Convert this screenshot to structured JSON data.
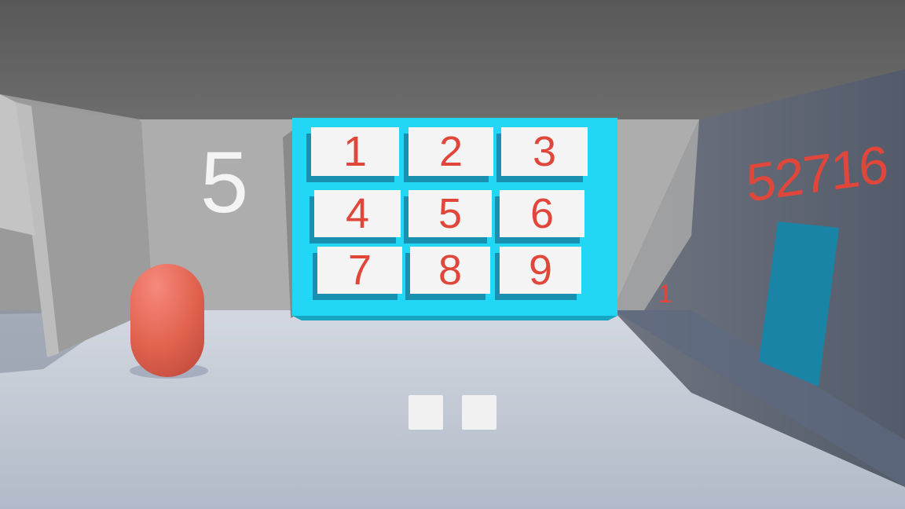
{
  "scene": {
    "colors": {
      "ceiling": "#5f5f5f",
      "back_wall": "#adadad",
      "floor": "#c2c9d6",
      "keypad_frame": "#22d6f5",
      "key_face": "#f4f4f4",
      "key_text": "#e0473a",
      "door": "#1a84a6",
      "capsule": "#e86a5c"
    },
    "wall_digit": "5",
    "keypad": {
      "keys": [
        "1",
        "2",
        "3",
        "4",
        "5",
        "6",
        "7",
        "8",
        "9"
      ]
    },
    "right_wall_code": "52716",
    "small_digit": "1",
    "hud": {
      "slots": [
        {
          "value": ""
        },
        {
          "value": ""
        }
      ]
    }
  }
}
